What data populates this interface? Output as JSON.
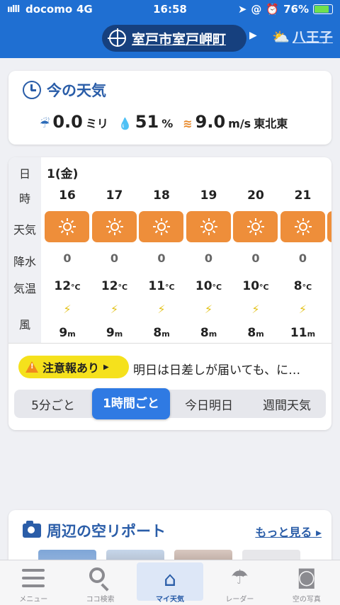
{
  "status_bar": {
    "signal": "ıılll",
    "carrier": "docomo",
    "network": "4G",
    "time": "16:58",
    "battery": "76%",
    "battery_level": 0.76
  },
  "header": {
    "current_location": "室戸市室戸岬町",
    "next_location": "八王子"
  },
  "current_weather": {
    "title": "今の天気",
    "rain_value": "0.0",
    "rain_unit": "ミリ",
    "humidity_value": "51",
    "humidity_unit": "%",
    "wind_value": "9.0",
    "wind_unit": "m/s",
    "wind_direction": "東北東"
  },
  "hourly": {
    "row_labels": {
      "day": "日",
      "hour": "時",
      "weather": "天気",
      "precip": "降水",
      "temp": "気温",
      "wind": "風"
    },
    "date": "1(金)",
    "temp_unit": "°C",
    "wind_unit": "m",
    "hours": [
      {
        "hour": "16",
        "weather": "sunny",
        "precip": "0",
        "temp": "12",
        "wind_speed": "9"
      },
      {
        "hour": "17",
        "weather": "sunny",
        "precip": "0",
        "temp": "12",
        "wind_speed": "9"
      },
      {
        "hour": "18",
        "weather": "sunny",
        "precip": "0",
        "temp": "11",
        "wind_speed": "8"
      },
      {
        "hour": "19",
        "weather": "sunny",
        "precip": "0",
        "temp": "10",
        "wind_speed": "8"
      },
      {
        "hour": "20",
        "weather": "sunny",
        "precip": "0",
        "temp": "10",
        "wind_speed": "8"
      },
      {
        "hour": "21",
        "weather": "sunny",
        "precip": "0",
        "temp": "8",
        "wind_speed": "11"
      }
    ]
  },
  "warning": {
    "badge": "注意報あり",
    "text": "明日は日差しが届いても、に…"
  },
  "segments": [
    "5分ごと",
    "1時間ごと",
    "今日明日",
    "週間天気"
  ],
  "active_segment": "1時間ごと",
  "sky_report": {
    "title": "周辺の空リポート",
    "more_link": "もっと見る"
  },
  "tabbar": [
    {
      "label": "メニュー",
      "icon": "menu-icon"
    },
    {
      "label": "ココ検索",
      "icon": "search-icon"
    },
    {
      "label": "マイ天気",
      "icon": "home-icon"
    },
    {
      "label": "レーダー",
      "icon": "umbrella-icon"
    },
    {
      "label": "空の写真",
      "icon": "camera-icon"
    }
  ],
  "colors": {
    "header_blue": "#1f6fd2",
    "sunny_orange": "#ee8e3a",
    "warning_yellow": "#f5e11c",
    "active_blue": "#2f7ae3"
  }
}
